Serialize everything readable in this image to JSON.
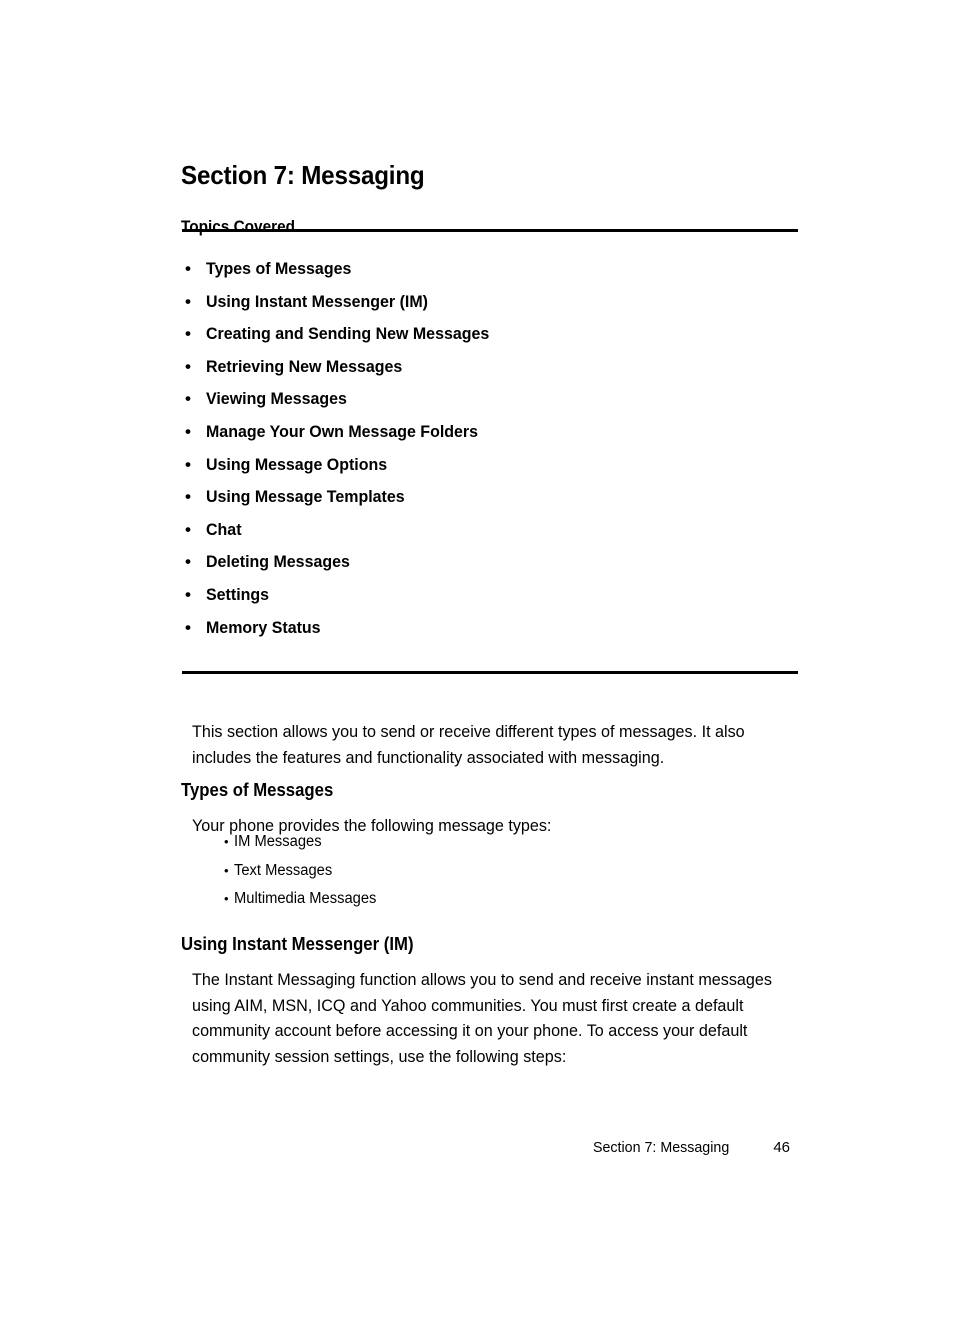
{
  "document": {
    "section_title": "Section 7: Messaging",
    "topics_heading": "Topics Covered",
    "topics": [
      "Types of Messages",
      "Using Instant Messenger (IM)",
      "Creating and Sending New Messages",
      "Retrieving New Messages",
      "Viewing Messages",
      "Manage Your Own Message Folders",
      "Using Message Options",
      "Using Message Templates",
      "Chat",
      "Deleting Messages",
      "Settings",
      "Memory Status"
    ],
    "bullet_glyph": "•",
    "intro_paragraph": "This section allows you to send or receive different types of messages. It also includes the features and functionality associated with messaging.",
    "types_of_messages": {
      "heading": "Types of Messages",
      "lead_in": "Your phone provides the following message types:",
      "items": [
        "IM Messages",
        "Text Messages",
        "Multimedia Messages"
      ]
    },
    "instant_messenger": {
      "heading": "Using Instant Messenger (IM)",
      "paragraph": "The Instant Messaging function allows you to send and receive instant messages using AIM, MSN, ICQ and Yahoo communities. You must first create a default community account before accessing it on your phone. To access your default community session settings, use the following steps:"
    },
    "footer": {
      "title": "Section 7: Messaging",
      "page_number": "46"
    },
    "colors": {
      "text": "#000000",
      "background": "#ffffff",
      "rule": "#000000"
    }
  }
}
